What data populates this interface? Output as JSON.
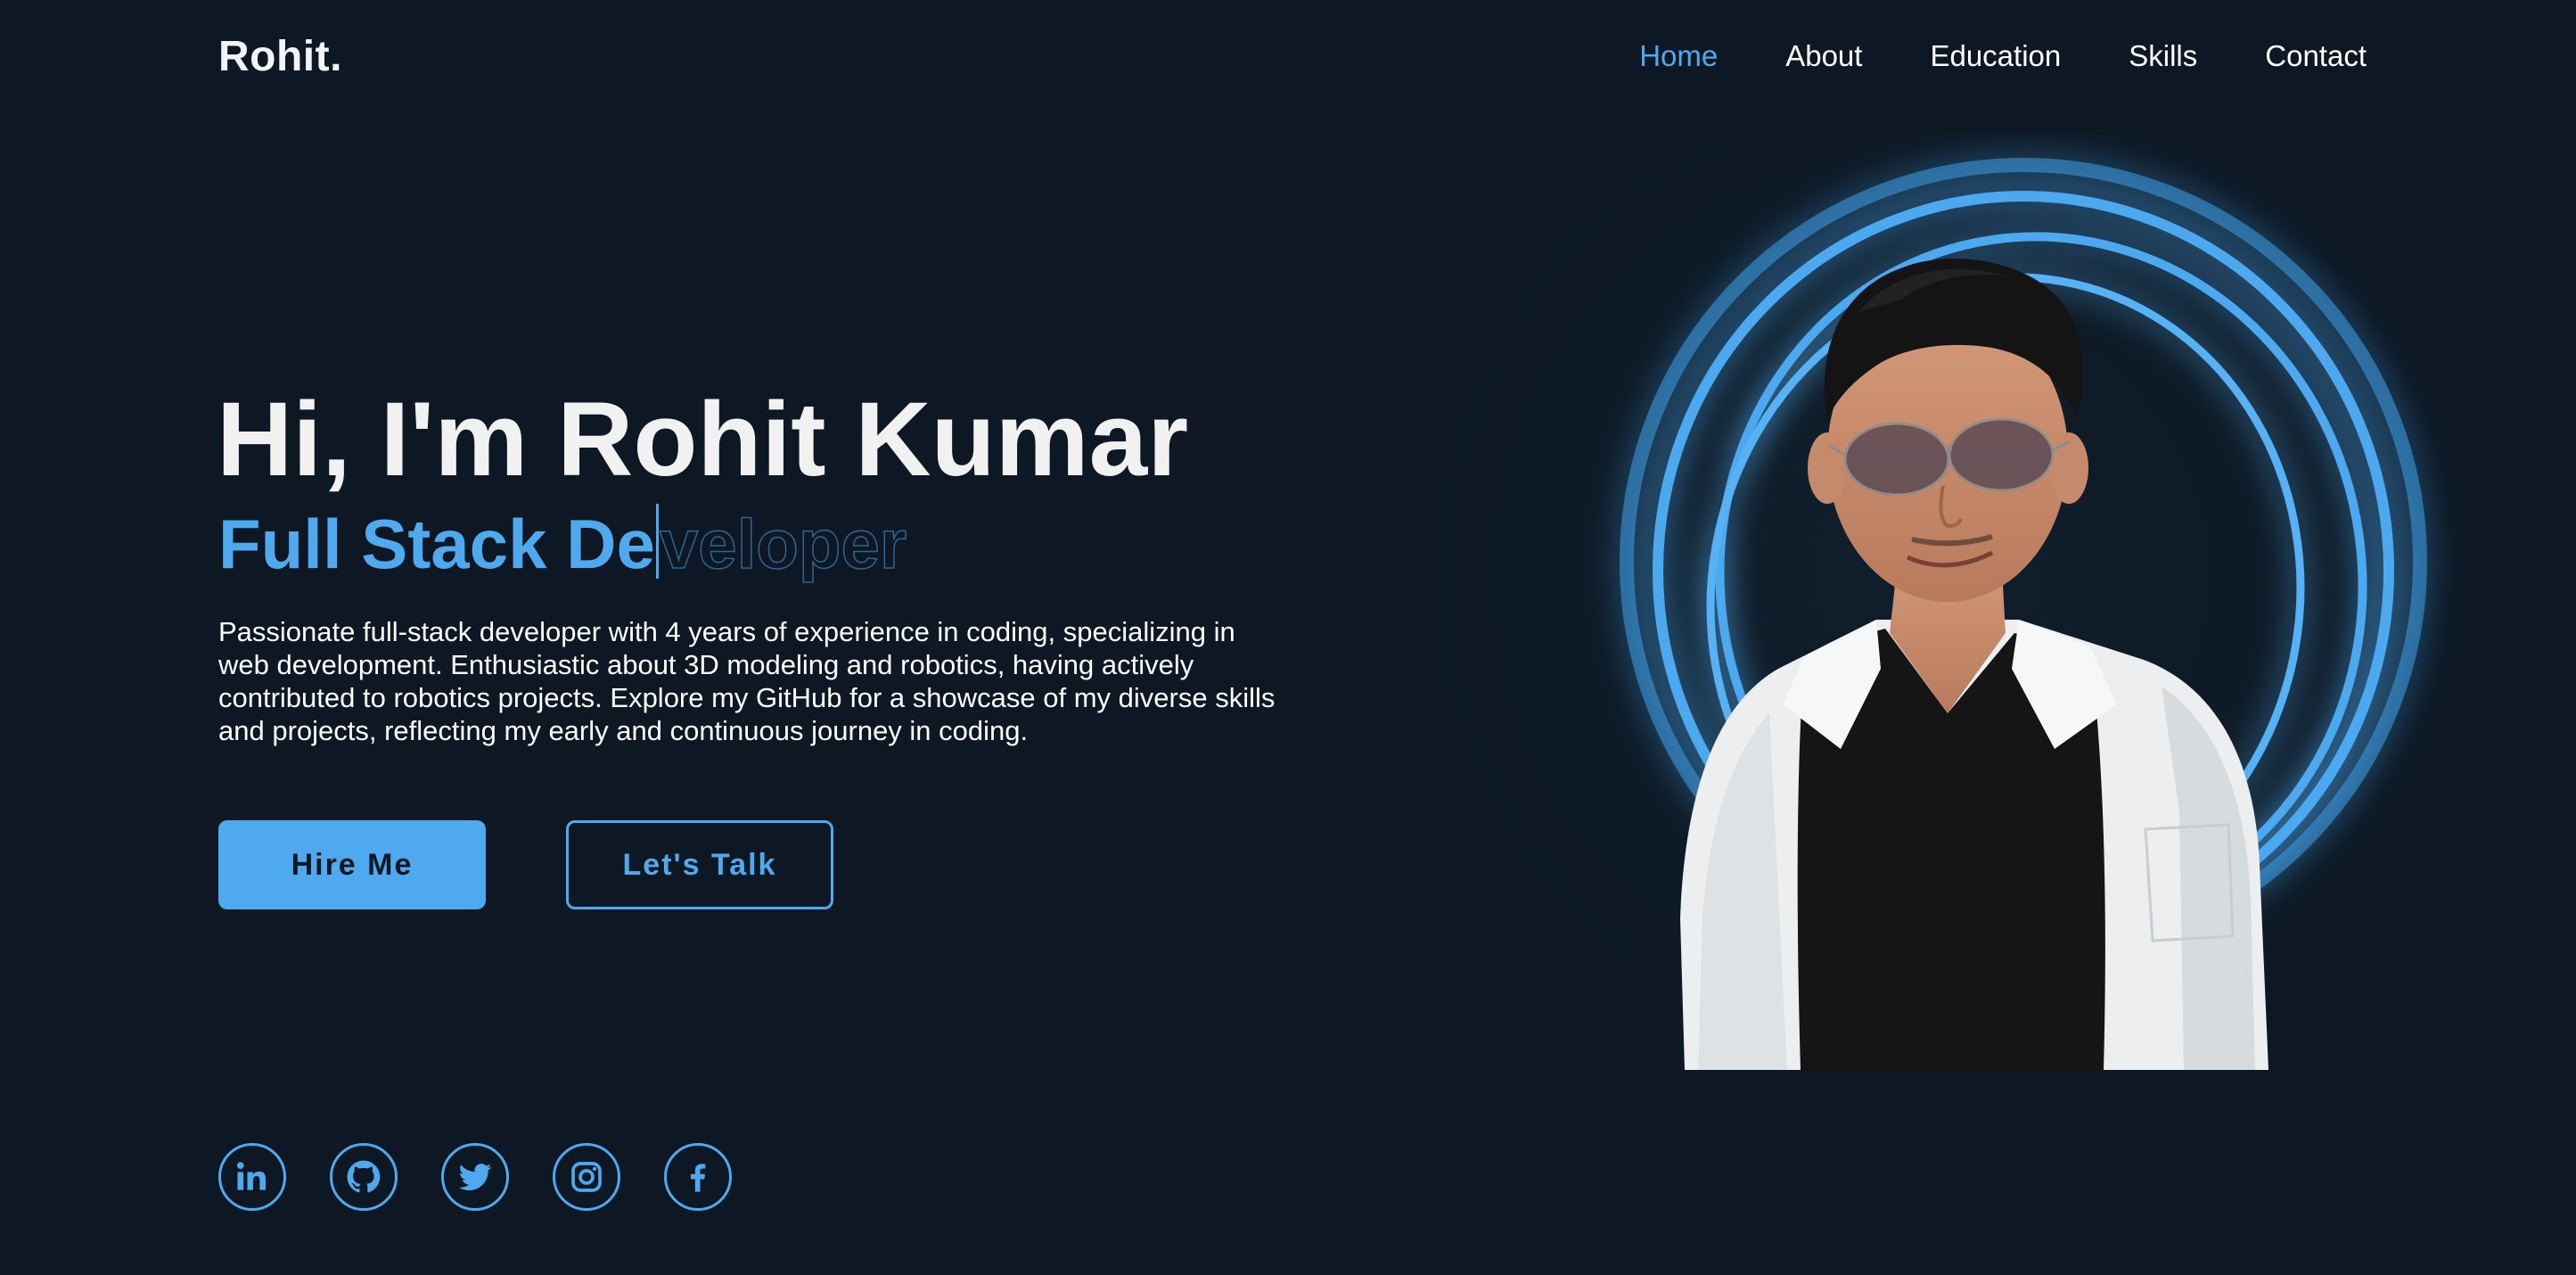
{
  "brand": {
    "logo": "Rohit."
  },
  "nav": {
    "items": [
      {
        "label": "Home",
        "active": true
      },
      {
        "label": "About",
        "active": false
      },
      {
        "label": "Education",
        "active": false
      },
      {
        "label": "Skills",
        "active": false
      },
      {
        "label": "Contact",
        "active": false
      }
    ]
  },
  "hero": {
    "title": "Hi, I'm Rohit Kumar",
    "role_typed": "Full Stack De",
    "role_remaining": "veloper",
    "description": "Passionate full-stack developer with 4 years of experience in coding, specializing in web development. Enthusiastic about 3D modeling and robotics, having actively contributed to robotics projects. Explore my GitHub for a showcase of my diverse skills and projects, reflecting my early and continuous journey in coding.",
    "buttons": {
      "primary": "Hire Me",
      "secondary": "Let's Talk"
    }
  },
  "socials": [
    {
      "icon": "linkedin-icon"
    },
    {
      "icon": "github-icon"
    },
    {
      "icon": "twitter-icon"
    },
    {
      "icon": "instagram-icon"
    },
    {
      "icon": "facebook-icon"
    }
  ],
  "colors": {
    "background": "#0d1824",
    "accent": "#4ea9ef",
    "text": "#ffffff"
  }
}
